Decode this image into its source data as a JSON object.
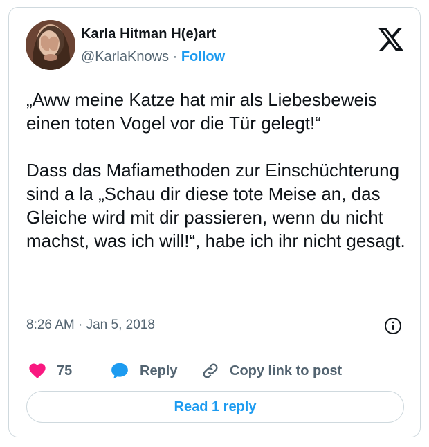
{
  "author": {
    "name": "Karla Hitman H(e)art",
    "handle": "@KarlaKnows",
    "separator": "·",
    "follow_label": "Follow"
  },
  "tweet": {
    "text": "„Aww meine Katze hat mir als Liebesbeweis einen toten Vogel vor die Tür gelegt!“\n\nDass das Mafiamethoden zur Einschüchterung sind a la „Schau dir diese tote Meise an, das Gleiche wird mit dir passieren, wenn du nicht machst, was ich will!“, habe ich ihr nicht gesagt.",
    "time": "8:26 AM",
    "date_separator": "·",
    "date": "Jan 5, 2018"
  },
  "actions": {
    "like_count": "75",
    "reply_label": "Reply",
    "copy_label": "Copy link to post"
  },
  "footer": {
    "read_replies_label": "Read 1 reply"
  },
  "colors": {
    "accent": "#1d9bf0",
    "like": "#f91880",
    "muted": "#536471",
    "text": "#0f1419"
  },
  "icons": [
    "x-logo-icon",
    "info-icon",
    "heart-icon",
    "reply-bubble-icon",
    "link-icon"
  ]
}
